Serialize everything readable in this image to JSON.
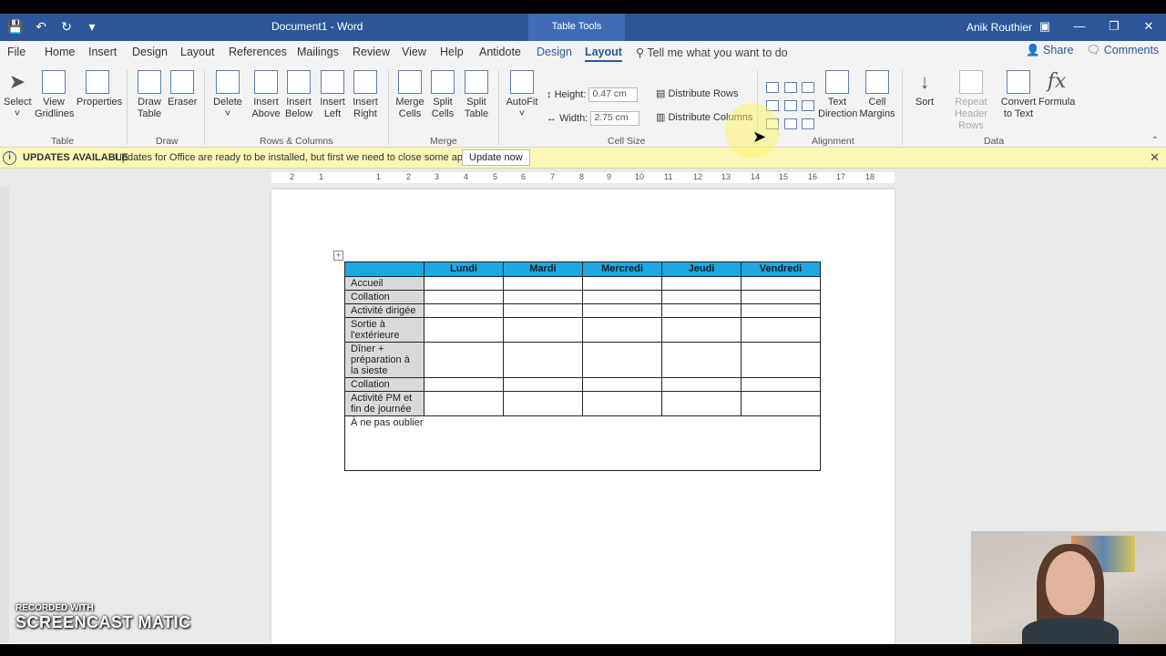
{
  "titlebar": {
    "doc_title": "Document1  -  Word",
    "contextual_label": "Table Tools",
    "user": "Anik Routhier"
  },
  "tabs": [
    "File",
    "Home",
    "Insert",
    "Design",
    "Layout",
    "References",
    "Mailings",
    "Review",
    "View",
    "Help",
    "Antidote",
    "Design",
    "Layout"
  ],
  "tell_me": "Tell me what you want to do",
  "share": "Share",
  "comments": "Comments",
  "ribbon": {
    "table": {
      "select": "Select",
      "view_gridlines": "View Gridlines",
      "properties": "Properties",
      "group": "Table"
    },
    "draw": {
      "draw_table": "Draw Table",
      "eraser": "Eraser",
      "group": "Draw"
    },
    "rows_cols": {
      "delete": "Delete",
      "insert_above": "Insert Above",
      "insert_below": "Insert Below",
      "insert_left": "Insert Left",
      "insert_right": "Insert Right",
      "group": "Rows & Columns"
    },
    "merge": {
      "merge_cells": "Merge Cells",
      "split_cells": "Split Cells",
      "split_table": "Split Table",
      "group": "Merge"
    },
    "cell_size": {
      "autofit": "AutoFit",
      "height_label": "Height:",
      "height_value": "0.47 cm",
      "width_label": "Width:",
      "width_value": "2.75 cm",
      "distribute_rows": "Distribute Rows",
      "distribute_columns": "Distribute Columns",
      "group": "Cell Size"
    },
    "alignment": {
      "text_direction": "Text Direction",
      "cell_margins": "Cell Margins",
      "group": "Alignment"
    },
    "data": {
      "sort": "Sort",
      "repeat_header": "Repeat Header Rows",
      "convert": "Convert to Text",
      "formula": "Formula",
      "group": "Data"
    }
  },
  "infobar": {
    "title": "UPDATES AVAILABLE",
    "message": "Updates for Office are ready to be installed, but first we need to close some apps.",
    "button": "Update now"
  },
  "ruler": [
    "2",
    "1",
    "1",
    "2",
    "3",
    "4",
    "5",
    "6",
    "7",
    "8",
    "9",
    "10",
    "11",
    "12",
    "13",
    "14",
    "15",
    "16",
    "17",
    "18"
  ],
  "table": {
    "headers": [
      "",
      "Lundi",
      "Mardi",
      "Mercredi",
      "Jeudi",
      "Vendredi"
    ],
    "rows": [
      [
        "Accueil"
      ],
      [
        "Collation"
      ],
      [
        "Activité dirigée"
      ],
      [
        "Sortie à l'extérieure"
      ],
      [
        "Dîner + préparation à la sieste"
      ],
      [
        "Collation"
      ],
      [
        "Activité PM et fin de journée"
      ]
    ],
    "notes": "À ne pas oublier"
  },
  "watermark": {
    "line1": "RECORDED WITH",
    "line2": "SCREENCAST  MATIC"
  }
}
